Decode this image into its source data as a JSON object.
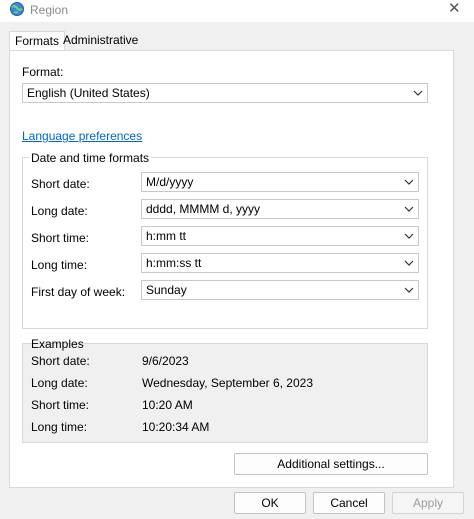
{
  "window": {
    "title": "Region",
    "close_glyph": "✕"
  },
  "tabs": [
    {
      "label": "Formats",
      "active": true
    },
    {
      "label": "Administrative",
      "active": false
    }
  ],
  "format": {
    "label": "Format:",
    "value": "English (United States)"
  },
  "language_link": "Language preferences",
  "date_time": {
    "title": "Date and time formats",
    "rows": [
      {
        "label": "Short date:",
        "value": "M/d/yyyy"
      },
      {
        "label": "Long date:",
        "value": "dddd, MMMM d, yyyy"
      },
      {
        "label": "Short time:",
        "value": "h:mm tt"
      },
      {
        "label": "Long time:",
        "value": "h:mm:ss tt"
      },
      {
        "label": "First day of week:",
        "value": "Sunday"
      }
    ]
  },
  "examples": {
    "title": "Examples",
    "rows": [
      {
        "label": "Short date:",
        "value": "9/6/2023"
      },
      {
        "label": "Long date:",
        "value": "Wednesday, September 6, 2023"
      },
      {
        "label": "Short time:",
        "value": "10:20 AM"
      },
      {
        "label": "Long time:",
        "value": "10:20:34 AM"
      }
    ]
  },
  "buttons": {
    "additional": "Additional settings...",
    "ok": "OK",
    "cancel": "Cancel",
    "apply": "Apply"
  }
}
